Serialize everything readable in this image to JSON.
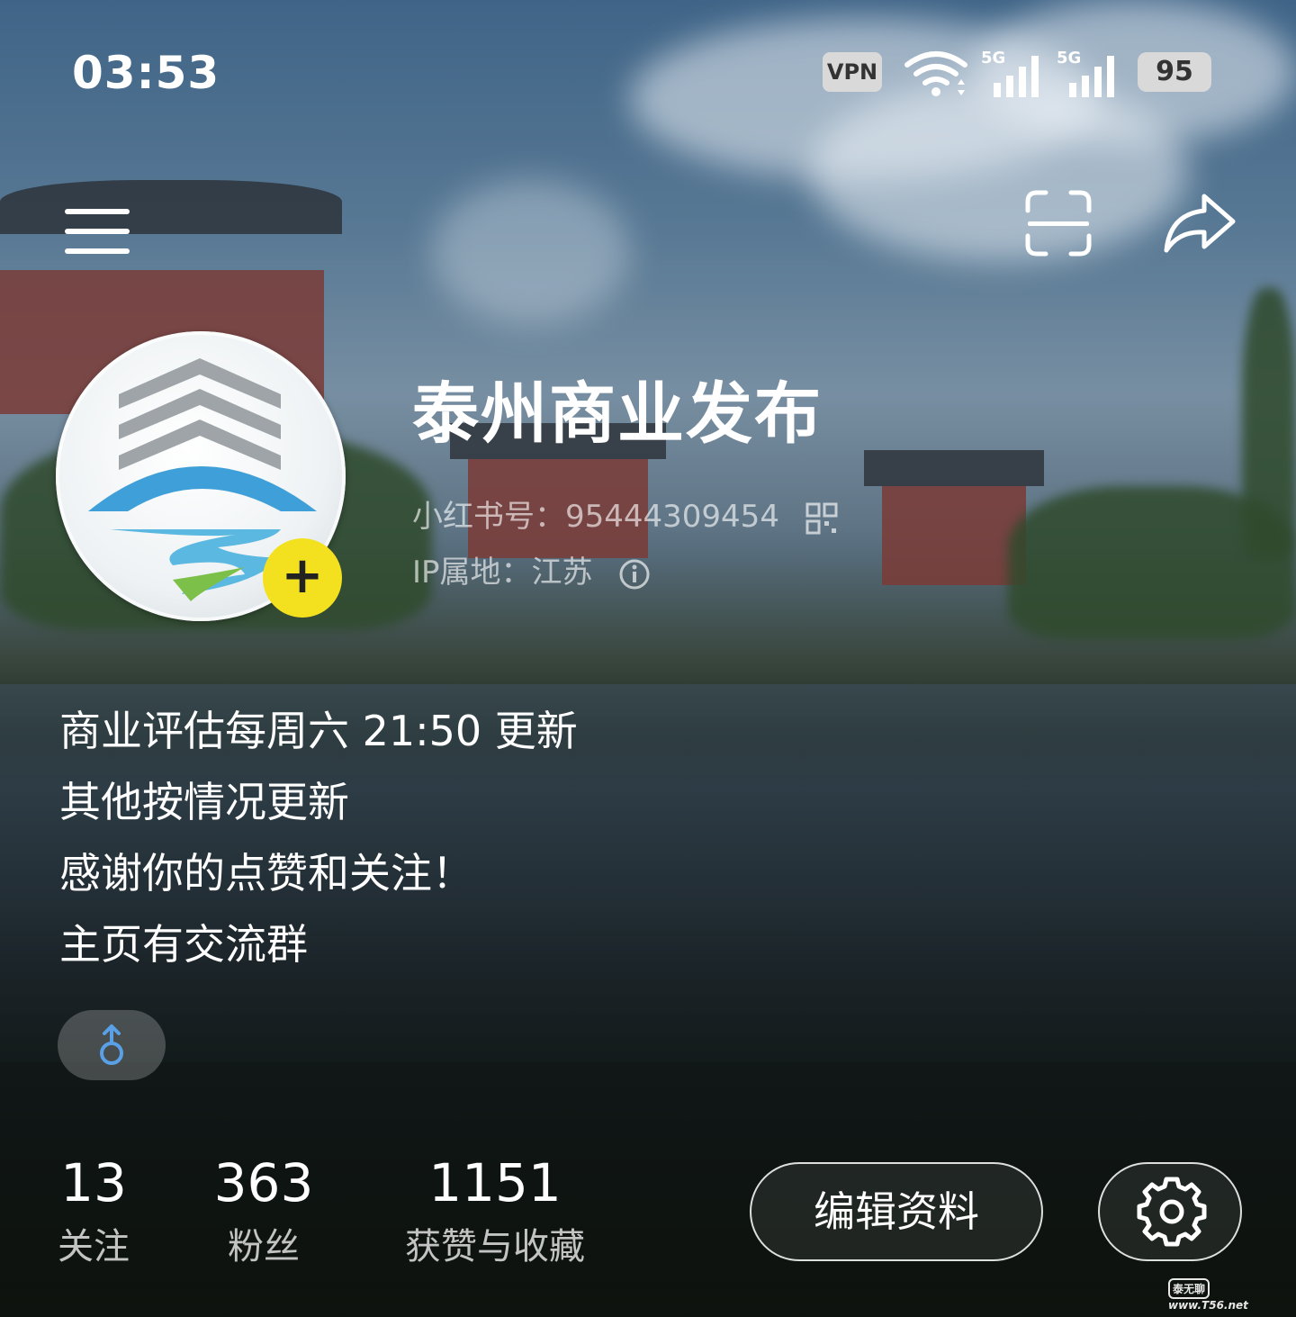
{
  "status_bar": {
    "time": "03:53",
    "vpn": "VPN",
    "sim1": "5G",
    "sim2": "5G",
    "battery": "95"
  },
  "top_bar": {
    "menu_icon": "menu-icon",
    "scan_icon": "scan-icon",
    "share_icon": "share-icon"
  },
  "profile": {
    "name": "泰州商业发布",
    "id_line": "小红书号：95444309454",
    "ip_line": "IP属地：江苏",
    "bio": [
      "商业评估每周六 21:50 更新",
      "其他按情况更新",
      "感谢你的点赞和关注！",
      "主页有交流群"
    ],
    "gender_icon": "male-icon",
    "add_badge": "+"
  },
  "stats": [
    {
      "num": "13",
      "label": "关注"
    },
    {
      "num": "363",
      "label": "粉丝"
    },
    {
      "num": "1151",
      "label": "获赞与收藏"
    }
  ],
  "actions": {
    "edit_label": "编辑资料",
    "settings_icon": "gear-icon"
  },
  "watermark": {
    "box": "泰无聊",
    "site": "www.T56.net"
  },
  "colors": {
    "badge": "#f3e11f",
    "gender": "#5aa0e6"
  }
}
